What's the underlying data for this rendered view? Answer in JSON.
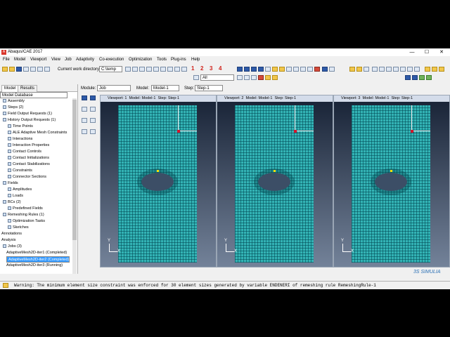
{
  "window": {
    "title": "Abaqus/CAE 2017",
    "minimize": "—",
    "maximize": "☐",
    "close": "✕"
  },
  "menus": [
    "File",
    "Model",
    "Viewport",
    "View",
    "Job",
    "Adaptivity",
    "Co-execution",
    "Optimization",
    "Tools",
    "Plug-ins",
    "Help"
  ],
  "toolbar": {
    "work_dir_label": "Current work directory:",
    "work_dir_value": "C:\\temp",
    "numbers": [
      "1",
      "2",
      "3",
      "4"
    ],
    "filter_value": "All"
  },
  "context": {
    "module_label": "Module:",
    "module_value": "Job",
    "model_label": "Model:",
    "model_value": "Model-1",
    "step_label": "Step:",
    "step_value": "Step-1"
  },
  "tabs": [
    "Model",
    "Results"
  ],
  "tree": {
    "database": "Model Database",
    "items": [
      "Assembly",
      "Steps (2)",
      "Field Output Requests (1)",
      "History Output Requests (1)",
      "Time Points",
      "ALE Adaptive Mesh Constraints",
      "Interactions",
      "Interaction Properties",
      "Contact Controls",
      "Contact Initializations",
      "Contact Stabilizations",
      "Constraints",
      "Connector Sections",
      "Fields",
      "Amplitudes",
      "Loads",
      "BCs (2)",
      "Predefined Fields",
      "Remeshing Rules (1)",
      "Optimization Tasks",
      "Sketches",
      "Annotations",
      "Analysis",
      "Jobs (3)",
      "AdaptiveMesh2D-iter1 (Completed)",
      "AdaptiveMesh2D-iter2 (Completed)",
      "AdaptiveMesh2D-iter3 (Running)"
    ]
  },
  "viewports": [
    {
      "title": "Viewport: 1",
      "model": "Model: Model-1",
      "step": "Step: Step-1"
    },
    {
      "title": "Viewport: 2",
      "model": "Model: Model-1",
      "step": "Step: Step-1"
    },
    {
      "title": "Viewport: 3",
      "model": "Model: Model-1",
      "step": "Step: Step-1"
    }
  ],
  "triad": {
    "y": "Y",
    "x": "X"
  },
  "brand": "3S SIMULIA",
  "message": "Warning: The minimum element size constraint was enforced for 30 element sizes generated by variable ENDENERI of remeshing rule RemeshingRule-1"
}
